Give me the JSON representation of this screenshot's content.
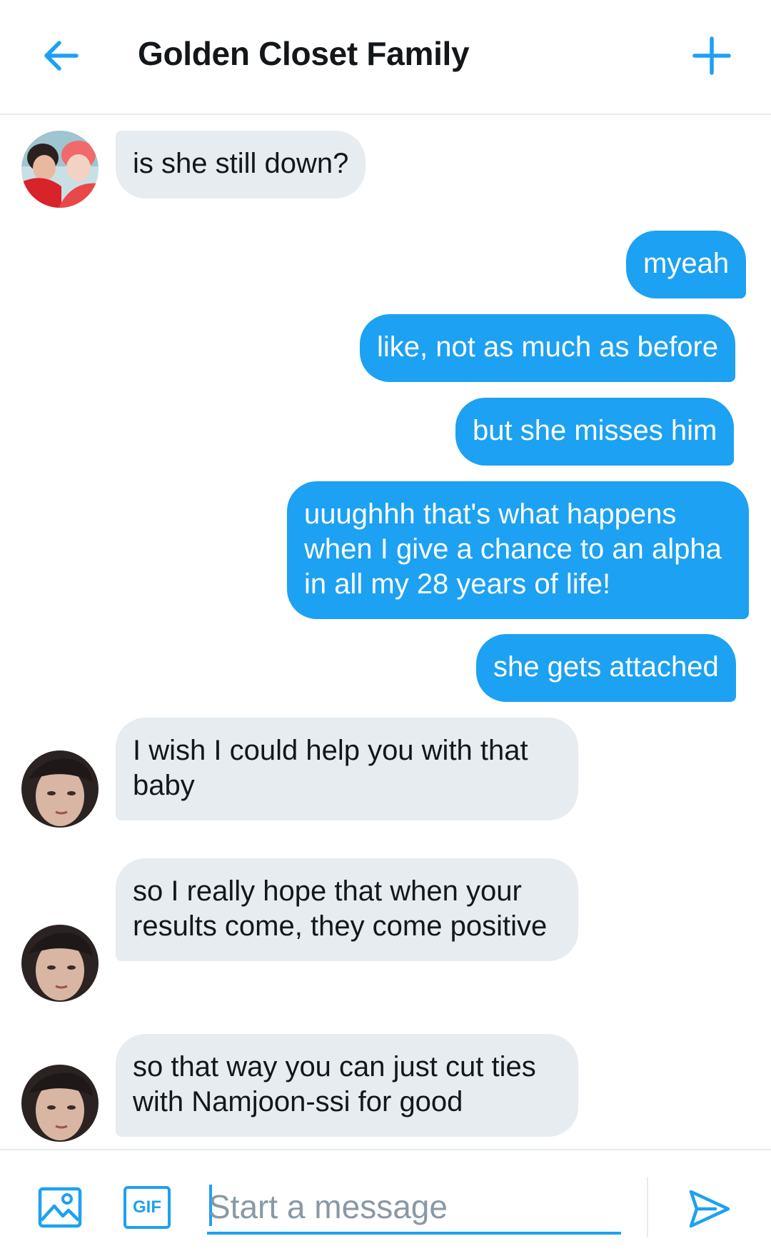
{
  "header": {
    "title": "Golden Closet Family",
    "back_icon": "arrow-left-icon",
    "new_icon": "plus-icon"
  },
  "messages": [
    {
      "side": "in",
      "text": "is she still down?"
    },
    {
      "side": "out",
      "text": "myeah"
    },
    {
      "side": "out",
      "text": "like, not as much as before"
    },
    {
      "side": "out",
      "text": "but she misses him"
    },
    {
      "side": "out",
      "text": "uuughhh that's what happens when I give a chance to an alpha in all my 28 years of life!"
    },
    {
      "side": "out",
      "text": "she gets attached"
    },
    {
      "side": "in",
      "text": "I wish I could help you with that baby"
    },
    {
      "side": "in",
      "text": "so I really hope that when your results come, they come positive"
    },
    {
      "side": "in",
      "text": "so that way you can just cut ties with Namjoon-ssi for good"
    }
  ],
  "composer": {
    "placeholder": "Start a message",
    "value": "",
    "gif_label": "GIF",
    "image_icon": "image-icon",
    "send_icon": "send-icon"
  },
  "colors": {
    "accent": "#1da1f2",
    "incoming_bubble": "#e6ecf0",
    "text": "#14171a",
    "placeholder": "#8899a6"
  }
}
